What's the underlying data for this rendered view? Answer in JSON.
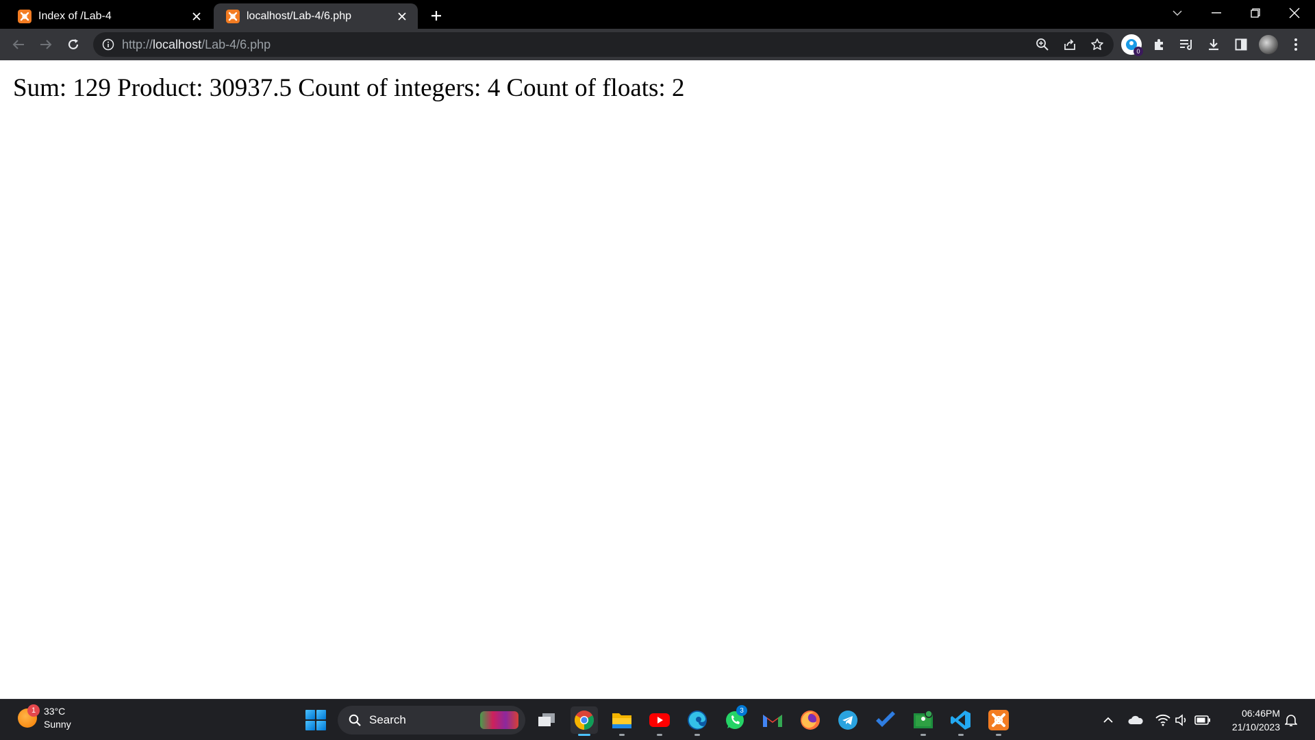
{
  "browser": {
    "tabs": [
      {
        "title": "Index of /Lab-4",
        "active": false
      },
      {
        "title": "localhost/Lab-4/6.php",
        "active": true
      }
    ],
    "url": {
      "scheme": "http://",
      "host": "localhost",
      "path": "/Lab-4/6.php"
    },
    "extension_badge": "0"
  },
  "page": {
    "output": "Sum: 129 Product: 30937.5 Count of integers: 4 Count of floats: 2"
  },
  "taskbar": {
    "weather": {
      "temp": "33°C",
      "condition": "Sunny",
      "badge": "1"
    },
    "search_label": "Search",
    "whatsapp_badge": "3",
    "clock": {
      "time": "06:46PM",
      "date": "21/10/2023"
    }
  },
  "colors": {
    "titlebar": "#000000",
    "toolbar": "#35363a",
    "omnibox": "#202124",
    "taskbar": "#1f2024",
    "xampp_orange": "#f37c22",
    "accent": "#4cc2ff"
  },
  "icons": {
    "tabs": [
      "xampp-favicon-icon",
      "close-icon"
    ],
    "toolbar": [
      "back-icon",
      "forward-icon",
      "reload-icon",
      "info-icon",
      "zoom-icon",
      "share-icon",
      "star-icon",
      "extensions-icon",
      "reading-list-icon",
      "download-icon",
      "side-panel-icon",
      "menu-icon"
    ],
    "taskbar": [
      "windows-start-icon",
      "search-icon",
      "task-view-icon",
      "chrome-icon",
      "file-explorer-icon",
      "youtube-icon",
      "edge-icon",
      "whatsapp-icon",
      "gmail-icon",
      "firefox-icon",
      "telegram-icon",
      "todo-icon",
      "classroom-icon",
      "vscode-icon",
      "xampp-icon",
      "chevron-up-icon",
      "onedrive-icon",
      "wifi-icon",
      "volume-icon",
      "battery-icon",
      "bell-icon"
    ]
  }
}
